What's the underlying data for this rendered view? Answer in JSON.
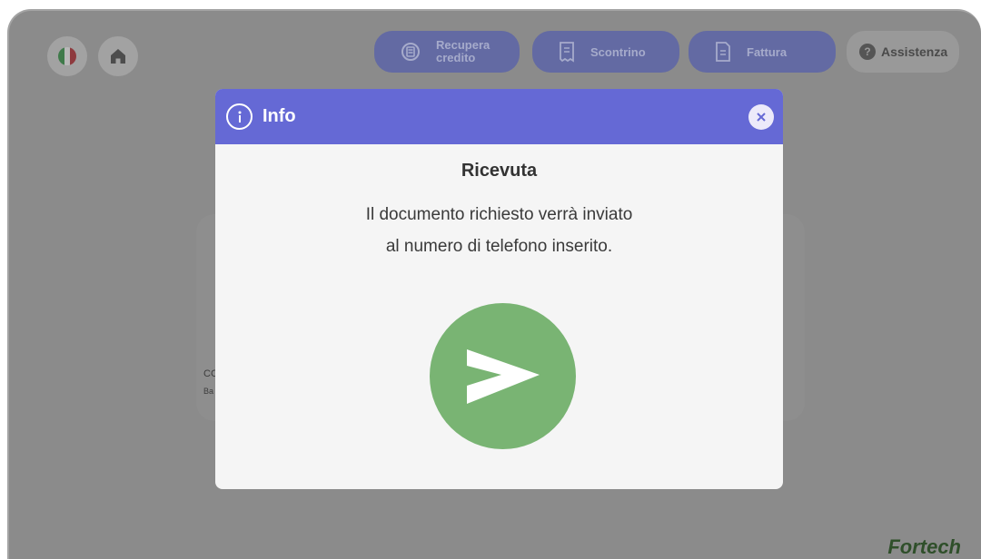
{
  "header": {
    "language_flag_colors": [
      "#009246",
      "#ffffff",
      "#ce2b37"
    ],
    "home_icon": "home-icon",
    "buttons": [
      {
        "label": "Recupera credito",
        "icon": "credit-recovery-icon"
      },
      {
        "label": "Scontrino",
        "icon": "receipt-icon"
      },
      {
        "label": "Fattura",
        "icon": "invoice-icon"
      }
    ],
    "assistance": {
      "label": "Assistenza",
      "icon_glyph": "?"
    }
  },
  "background_card": {
    "title": "CC",
    "subtitle": "Ba"
  },
  "brand": "Fortech",
  "modal": {
    "title": "Info",
    "heading": "Ricevuta",
    "message_lines": [
      "Il documento richiesto verrà inviato",
      "al numero di telefono inserito."
    ],
    "icon": "send-icon",
    "accent_color": "#6569d5",
    "success_color": "#79b473"
  }
}
